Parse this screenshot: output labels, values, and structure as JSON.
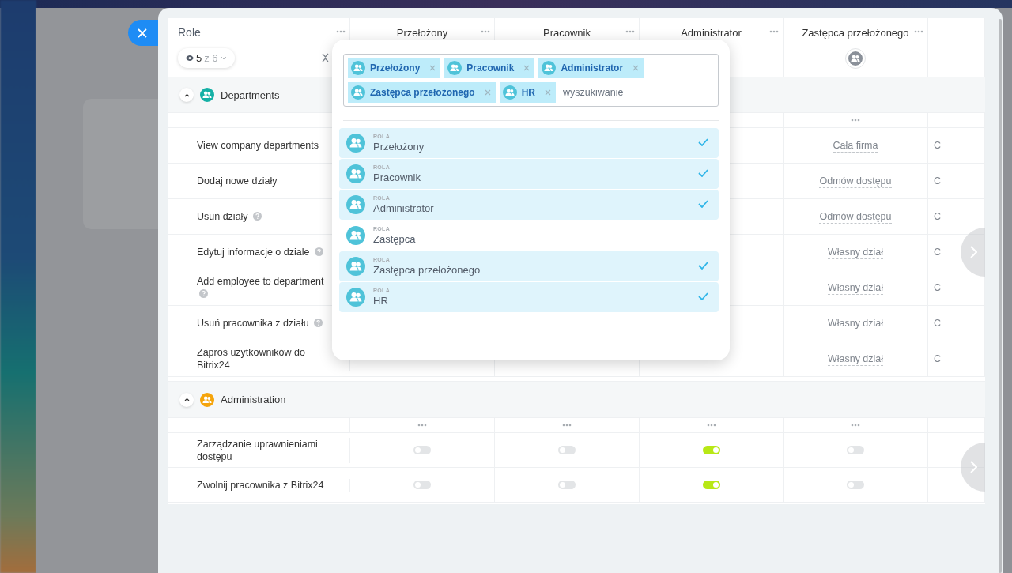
{
  "table": {
    "columns": [
      {
        "label": "Role",
        "kind": "role",
        "filter": {
          "shown": "5",
          "total": "z 6"
        }
      },
      {
        "label": "Przełożony",
        "kind": "role-column",
        "avatar": false
      },
      {
        "label": "Pracownik",
        "kind": "role-column",
        "avatar": false
      },
      {
        "label": "Administrator",
        "kind": "role-column",
        "avatar": false
      },
      {
        "label": "Zastępca przełożonego",
        "kind": "role-column",
        "avatar": true
      }
    ],
    "sections": [
      {
        "title": "Departments",
        "color": "#14b0a5",
        "expanded": true,
        "kind": "access",
        "rows": [
          {
            "label": "View company departments",
            "help": false,
            "value": "Cała firma",
            "next_column": "C"
          },
          {
            "label": "Dodaj nowe działy",
            "help": false,
            "value": "Odmów dostępu",
            "next_column": "C"
          },
          {
            "label": "Usuń działy",
            "help": true,
            "value": "Odmów dostępu",
            "next_column": "C"
          },
          {
            "label": "Edytuj informacje o dziale",
            "help": true,
            "value": "Własny dział",
            "next_column": "C"
          },
          {
            "label": "Add employee to department",
            "help": true,
            "value": "Własny dział",
            "next_column": "C"
          },
          {
            "label": "Usuń pracownika z działu",
            "help": true,
            "value": "Własny dział",
            "next_column": "C"
          },
          {
            "label": "Zaproś użytkowników do Bitrix24",
            "help": false,
            "value": "Własny dział",
            "next_column": "C"
          }
        ]
      },
      {
        "title": "Administration",
        "color": "#f5a40b",
        "expanded": true,
        "kind": "toggle",
        "rows": [
          {
            "label": "Zarządzanie uprawnieniami dostępu",
            "help": false,
            "toggles": [
              {
                "on": false
              },
              {
                "on": false
              },
              {
                "on": true
              },
              {
                "on": false
              }
            ]
          },
          {
            "label": "Zwolnij pracownika z Bitrix24",
            "help": false,
            "toggles": [
              {
                "on": false
              },
              {
                "on": false
              },
              {
                "on": true
              },
              {
                "on": false
              }
            ]
          }
        ]
      }
    ]
  },
  "role_picker": {
    "tags": [
      {
        "label": "Przełożony"
      },
      {
        "label": "Pracownik"
      },
      {
        "label": "Administrator"
      },
      {
        "label": "Zastępca przełożonego"
      },
      {
        "label": "HR"
      }
    ],
    "search": {
      "placeholder": "wyszukiwanie"
    },
    "items": [
      {
        "caption": "ROLA",
        "label": "Przełożony",
        "selected": true
      },
      {
        "caption": "ROLA",
        "label": "Pracownik",
        "selected": true
      },
      {
        "caption": "ROLA",
        "label": "Administrator",
        "selected": true
      },
      {
        "caption": "ROLA",
        "label": "Zastępca",
        "selected": false
      },
      {
        "caption": "ROLA",
        "label": "Zastępca przełożonego",
        "selected": true
      },
      {
        "caption": "ROLA",
        "label": "HR",
        "selected": true
      }
    ]
  }
}
